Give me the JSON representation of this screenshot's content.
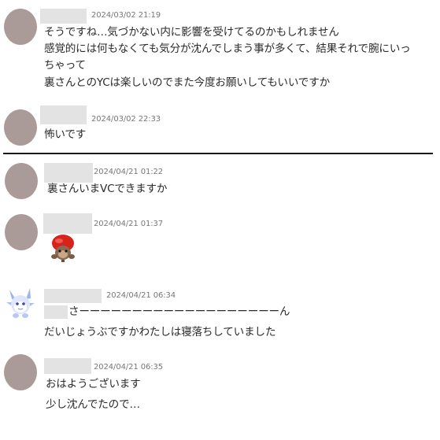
{
  "messages": [
    {
      "timestamp": "2024/03/02 21:19",
      "lines": [
        "そうですね…気づかない内に影響を受けてるのかもしれません",
        "感覚的には何もなくても気分が沈んでしまう事が多くて、結果それで腕にいっ",
        "ちゃって",
        "裏さんとのYCは楽しいのでまた今度お願いしてもいいですか"
      ]
    },
    {
      "timestamp": "2024/03/02 22:33",
      "lines": [
        "怖いです"
      ]
    },
    {
      "timestamp": "2024/04/21 01:22",
      "lines": [
        "裏さんいまVCできますか"
      ]
    },
    {
      "timestamp": "2024/04/21 01:37",
      "sticker": "apple-monkey-sticker",
      "lines": []
    },
    {
      "timestamp": "2024/04/21 06:34",
      "avatar": "blue-spiky-creature-avatar",
      "lines": [
        "さーーーーーーーーーーーーーーーーーーーん",
        "だいじょうぶですかわたしは寝落ちしていました"
      ]
    },
    {
      "timestamp": "2024/04/21 06:35",
      "lines": [
        "おはようございます",
        "少し沈んでたので…"
      ]
    }
  ],
  "colors": {
    "avatar": "#ab9b98",
    "name_redaction": "#e3e3e3",
    "divider": "#1a1a1a",
    "text": "#2b2b2b",
    "timestamp": "#777777"
  }
}
